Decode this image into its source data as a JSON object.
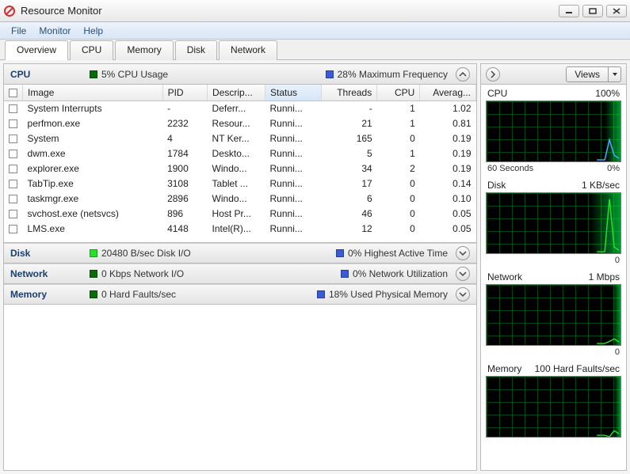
{
  "window": {
    "title": "Resource Monitor",
    "menus": [
      "File",
      "Monitor",
      "Help"
    ],
    "tabs": [
      "Overview",
      "CPU",
      "Memory",
      "Disk",
      "Network"
    ],
    "active_tab": "Overview"
  },
  "sections": {
    "cpu": {
      "title": "CPU",
      "metric1_label": "5% CPU Usage",
      "metric1_color": "#0a6b0a",
      "metric2_label": "28% Maximum Frequency",
      "metric2_color": "#3b5bd6",
      "expanded": true,
      "columns": [
        "Image",
        "PID",
        "Descrip...",
        "Status",
        "Threads",
        "CPU",
        "Averag..."
      ],
      "sorted_col": "Status",
      "rows": [
        {
          "image": "System Interrupts",
          "pid": "-",
          "desc": "Deferr...",
          "status": "Runni...",
          "threads": "-",
          "cpu": "1",
          "avg": "1.02"
        },
        {
          "image": "perfmon.exe",
          "pid": "2232",
          "desc": "Resour...",
          "status": "Runni...",
          "threads": "21",
          "cpu": "1",
          "avg": "0.81"
        },
        {
          "image": "System",
          "pid": "4",
          "desc": "NT Ker...",
          "status": "Runni...",
          "threads": "165",
          "cpu": "0",
          "avg": "0.19"
        },
        {
          "image": "dwm.exe",
          "pid": "1784",
          "desc": "Deskto...",
          "status": "Runni...",
          "threads": "5",
          "cpu": "1",
          "avg": "0.19"
        },
        {
          "image": "explorer.exe",
          "pid": "1900",
          "desc": "Windo...",
          "status": "Runni...",
          "threads": "34",
          "cpu": "2",
          "avg": "0.19"
        },
        {
          "image": "TabTip.exe",
          "pid": "3108",
          "desc": "Tablet ...",
          "status": "Runni...",
          "threads": "17",
          "cpu": "0",
          "avg": "0.14"
        },
        {
          "image": "taskmgr.exe",
          "pid": "2896",
          "desc": "Windo...",
          "status": "Runni...",
          "threads": "6",
          "cpu": "0",
          "avg": "0.10"
        },
        {
          "image": "svchost.exe (netsvcs)",
          "pid": "896",
          "desc": "Host Pr...",
          "status": "Runni...",
          "threads": "46",
          "cpu": "0",
          "avg": "0.05"
        },
        {
          "image": "LMS.exe",
          "pid": "4148",
          "desc": "Intel(R)...",
          "status": "Runni...",
          "threads": "12",
          "cpu": "0",
          "avg": "0.05"
        }
      ]
    },
    "disk": {
      "title": "Disk",
      "metric1_label": "20480 B/sec Disk I/O",
      "metric1_color": "#28e028",
      "metric2_label": "0% Highest Active Time",
      "metric2_color": "#3b5bd6"
    },
    "network": {
      "title": "Network",
      "metric1_label": "0 Kbps Network I/O",
      "metric1_color": "#0a6b0a",
      "metric2_label": "0% Network Utilization",
      "metric2_color": "#3b5bd6"
    },
    "memory": {
      "title": "Memory",
      "metric1_label": "0 Hard Faults/sec",
      "metric1_color": "#0a6b0a",
      "metric2_label": "18% Used Physical Memory",
      "metric2_color": "#3b5bd6"
    }
  },
  "right_pane": {
    "views_label": "Views",
    "charts": [
      {
        "title": "CPU",
        "scale": "100%",
        "xmin": "60 Seconds",
        "xmax": "0%",
        "line_color": "#57a8ff",
        "fill_pct": 12
      },
      {
        "title": "Disk",
        "scale": "1 KB/sec",
        "xmin": "",
        "xmax": "0",
        "line_color": "#28e028",
        "fill_pct": 30
      },
      {
        "title": "Network",
        "scale": "1 Mbps",
        "xmin": "",
        "xmax": "0",
        "line_color": "#28e028",
        "fill_pct": 2
      },
      {
        "title": "Memory",
        "scale": "100 Hard Faults/sec",
        "xmin": "",
        "xmax": "",
        "line_color": "#28e028",
        "fill_pct": 0
      }
    ]
  },
  "chart_data": [
    {
      "type": "line",
      "title": "CPU",
      "ylabel": "",
      "ylim": [
        0,
        100
      ],
      "x_range": "60 Seconds",
      "series": [
        {
          "name": "CPU",
          "values": [
            3,
            4,
            5,
            6,
            8,
            30,
            12,
            8,
            5
          ]
        }
      ]
    },
    {
      "type": "line",
      "title": "Disk",
      "ylabel": "KB/sec",
      "ylim": [
        0,
        1
      ],
      "series": [
        {
          "name": "Disk I/O",
          "values": [
            0,
            0,
            0,
            0,
            0,
            1,
            1,
            0
          ]
        }
      ]
    },
    {
      "type": "line",
      "title": "Network",
      "ylabel": "Mbps",
      "ylim": [
        0,
        1
      ],
      "series": [
        {
          "name": "Network",
          "values": [
            0,
            0,
            0,
            0,
            0,
            0,
            0,
            0
          ]
        }
      ]
    },
    {
      "type": "line",
      "title": "Memory",
      "ylabel": "Hard Faults/sec",
      "ylim": [
        0,
        100
      ],
      "series": [
        {
          "name": "Hard Faults",
          "values": [
            0,
            0,
            0,
            0,
            0,
            0,
            0,
            0
          ]
        }
      ]
    }
  ]
}
